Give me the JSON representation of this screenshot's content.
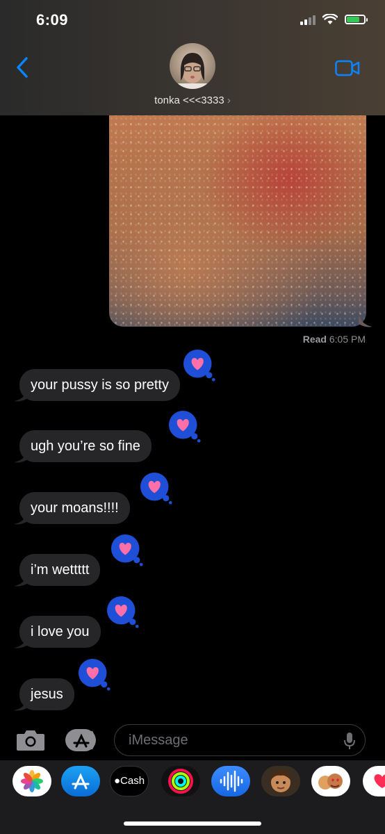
{
  "status_bar": {
    "time": "6:09"
  },
  "header": {
    "contact_name": "tonka <<<3333",
    "chevron": "›"
  },
  "read_receipt": {
    "label": "Read",
    "time": "6:05 PM"
  },
  "messages": [
    {
      "text": "your pussy is so pretty",
      "reaction": "heart"
    },
    {
      "text": "ugh you’re so fine",
      "reaction": "heart"
    },
    {
      "text": "your moans!!!!",
      "reaction": "heart"
    },
    {
      "text": "i’m wettttt",
      "reaction": "heart"
    },
    {
      "text": "i love you",
      "reaction": "heart"
    },
    {
      "text": "jesus",
      "reaction": "heart"
    }
  ],
  "composer": {
    "placeholder": "iMessage"
  },
  "app_drawer": {
    "apps": [
      {
        "name": "photos-app-icon"
      },
      {
        "name": "app-store-icon"
      },
      {
        "name": "apple-cash-icon",
        "label": "Cash"
      },
      {
        "name": "activity-icon"
      },
      {
        "name": "audio-message-icon"
      },
      {
        "name": "memoji-icon"
      },
      {
        "name": "memoji-stickers-icon"
      },
      {
        "name": "digital-touch-icon"
      }
    ]
  },
  "colors": {
    "accent": "#0a84ff",
    "tapback": "#1f4fd6",
    "heart": "#ff6fa8",
    "bubble": "#262628"
  }
}
